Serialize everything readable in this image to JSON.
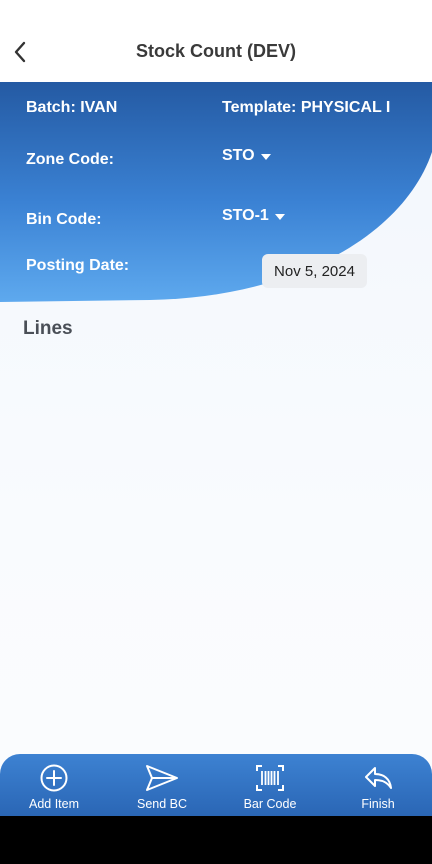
{
  "appbar": {
    "title": "Stock Count (DEV)",
    "back_icon": "chevron-left-icon"
  },
  "header": {
    "batch_label": "Batch: IVAN",
    "template_label": "Template: PHYSICAL I",
    "zone_label": "Zone Code:",
    "zone_value": "STO",
    "bin_label": "Bin Code:",
    "bin_value": "STO-1",
    "posting_label": "Posting Date:",
    "posting_value": "Nov 5, 2024"
  },
  "lines": {
    "heading": "Lines"
  },
  "bottom_nav": {
    "items": [
      {
        "label": "Add Item",
        "icon": "plus-circle-icon"
      },
      {
        "label": "Send BC",
        "icon": "send-icon"
      },
      {
        "label": "Bar Code",
        "icon": "barcode-scan-icon"
      },
      {
        "label": "Finish",
        "icon": "reply-icon"
      }
    ]
  },
  "colors": {
    "header_gradient_top": "#245aa3",
    "header_gradient_bottom": "#5aa6ec",
    "nav_bar": "#3578c9",
    "text_dark": "#3a3a3a"
  }
}
